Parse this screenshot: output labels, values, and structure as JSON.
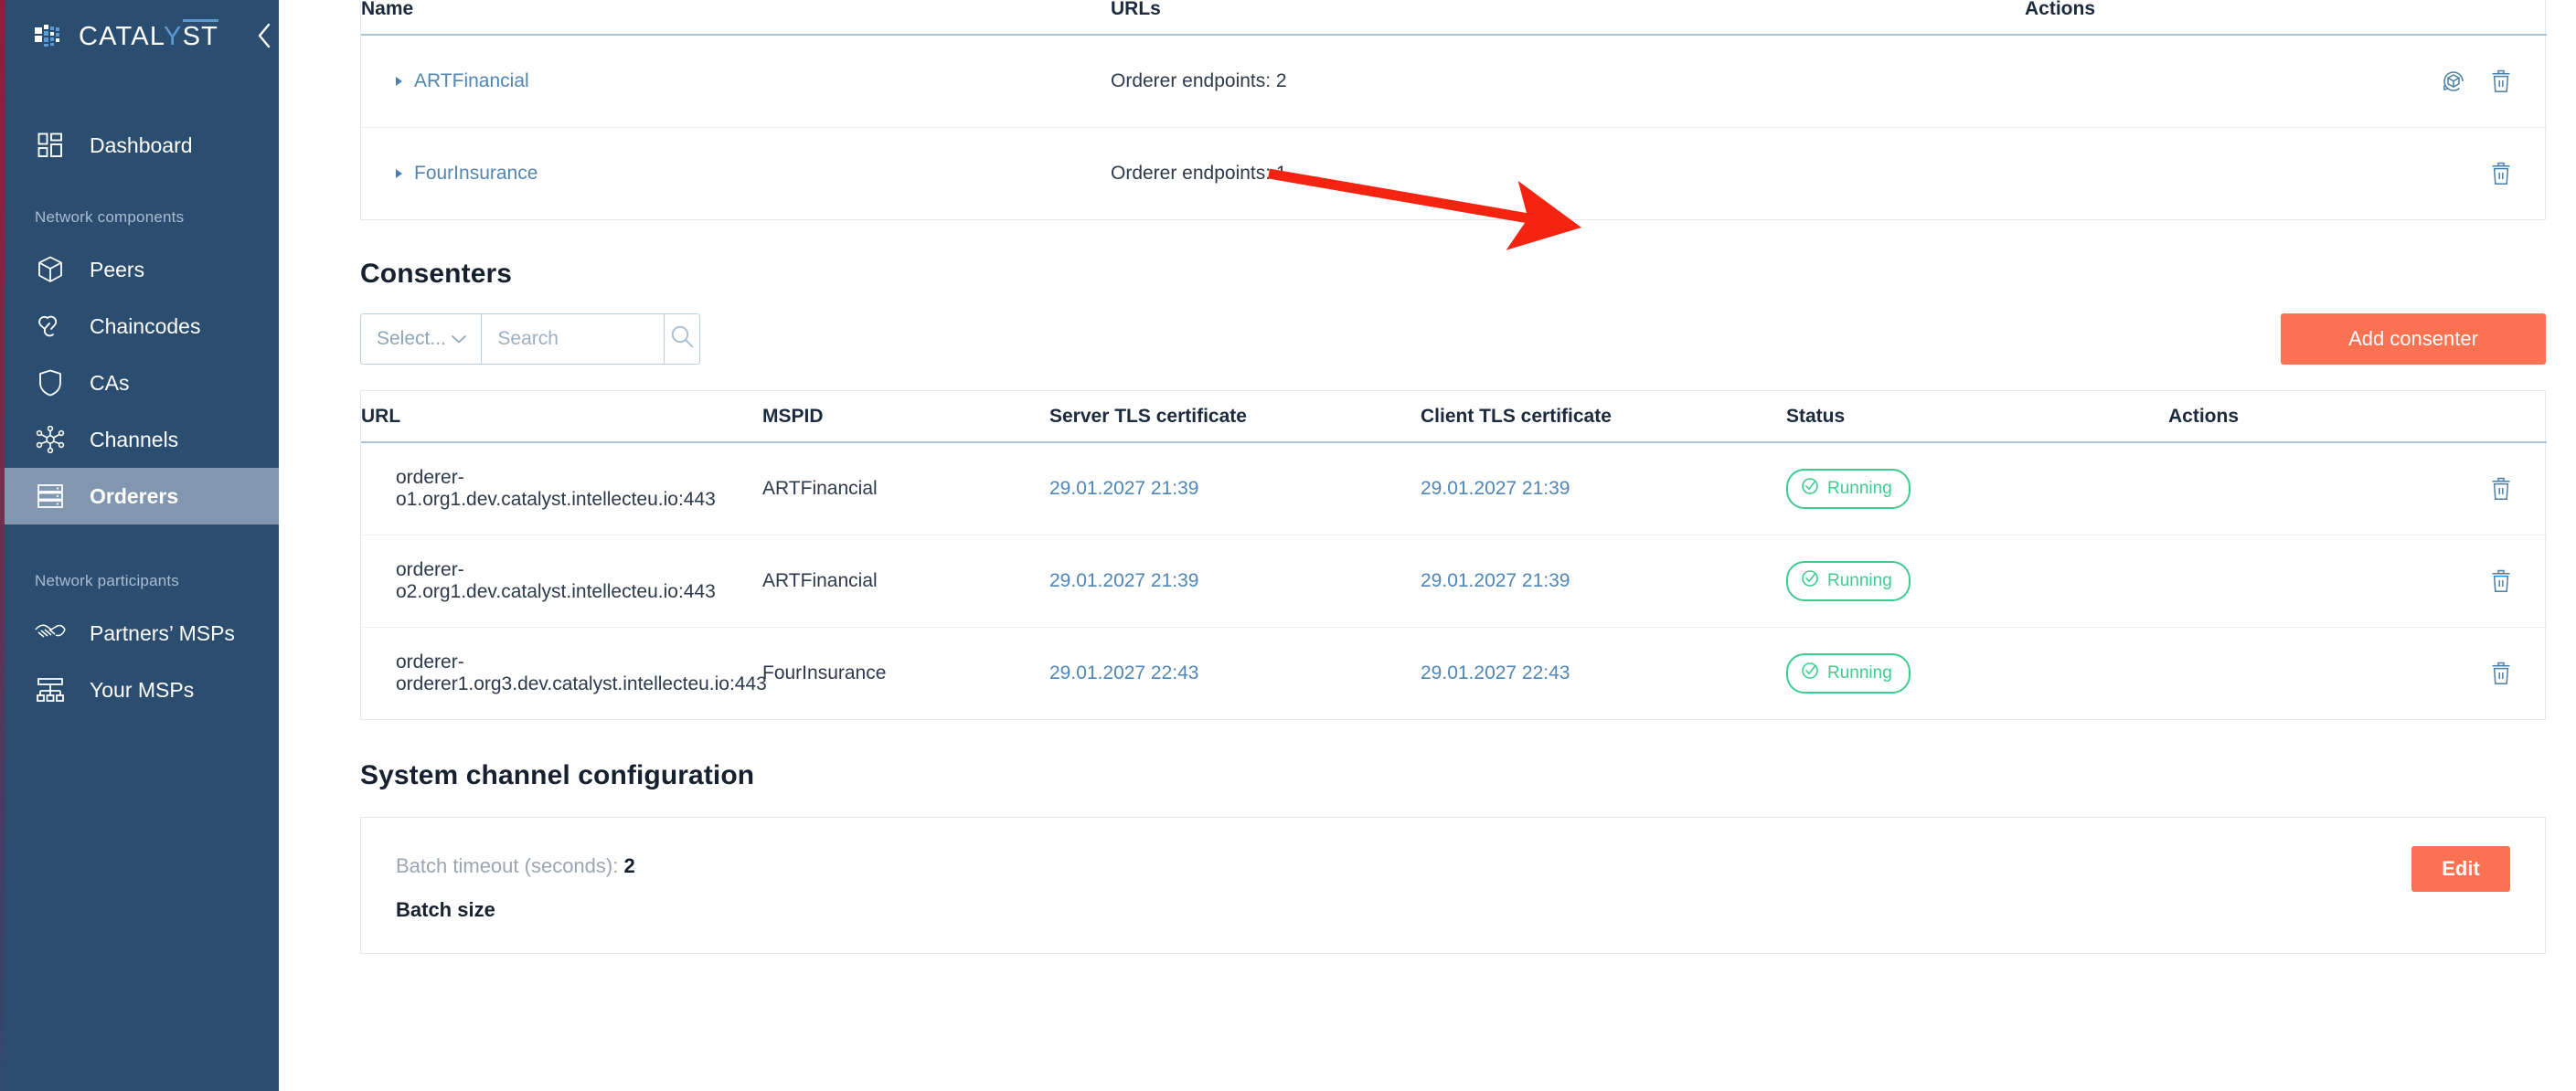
{
  "sidebar": {
    "brand": {
      "name_prefix": "CATAL",
      "name_accent": "Y",
      "name_suffix": "ST",
      "logo_icon": "catalyst-cube-logo-icon",
      "collapse_icon": "chevron-left-icon"
    },
    "groups": [
      {
        "label": "",
        "items": [
          {
            "label": "Dashboard",
            "icon": "dashboard-grid-icon",
            "active": false
          }
        ]
      },
      {
        "label": "Network components",
        "items": [
          {
            "label": "Peers",
            "icon": "cube-icon",
            "active": false
          },
          {
            "label": "Chaincodes",
            "icon": "link-chain-icon",
            "active": false
          },
          {
            "label": "CAs",
            "icon": "shield-icon",
            "active": false
          },
          {
            "label": "Channels",
            "icon": "network-nodes-icon",
            "active": false
          },
          {
            "label": "Orderers",
            "icon": "server-stack-icon",
            "active": true
          }
        ]
      },
      {
        "label": "Network participants",
        "items": [
          {
            "label": "Partners’ MSPs",
            "icon": "handshake-icon",
            "active": false
          },
          {
            "label": "Your MSPs",
            "icon": "org-hierarchy-icon",
            "active": false
          }
        ]
      }
    ]
  },
  "orderers_table": {
    "columns": [
      "Name",
      "URLs",
      "Actions"
    ],
    "rows": [
      {
        "name": "ARTFinancial",
        "urls": "Orderer endpoints: 2",
        "actions": [
          "restart-icon",
          "delete-icon"
        ]
      },
      {
        "name": "FourInsurance",
        "urls": "Orderer endpoints: 1",
        "actions": [
          "delete-icon"
        ]
      }
    ]
  },
  "consenters": {
    "title": "Consenters",
    "filter": {
      "select_value": "Select...",
      "search_placeholder": "Search",
      "search_value": "",
      "search_icon": "search-icon",
      "chevron_icon": "chevron-down-icon"
    },
    "add_button": {
      "label": "Add consenter",
      "color": "#fa7252"
    },
    "columns": [
      "URL",
      "MSPID",
      "Server TLS certificate",
      "Client TLS certificate",
      "Status",
      "Actions"
    ],
    "rows": [
      {
        "url": "orderer-o1.org1.dev.catalyst.intellecteu.io:443",
        "mspid": "ARTFinancial",
        "server_tls": "29.01.2027 21:39",
        "client_tls": "29.01.2027 21:39",
        "status": "Running",
        "action": "delete-icon"
      },
      {
        "url": "orderer-o2.org1.dev.catalyst.intellecteu.io:443",
        "mspid": "ARTFinancial",
        "server_tls": "29.01.2027 21:39",
        "client_tls": "29.01.2027 21:39",
        "status": "Running",
        "action": "delete-icon"
      },
      {
        "url": "orderer-orderer1.org3.dev.catalyst.intellecteu.io:443",
        "mspid": "FourInsurance",
        "server_tls": "29.01.2027 22:43",
        "client_tls": "29.01.2027 22:43",
        "status": "Running",
        "action": "delete-icon"
      }
    ],
    "status_color": "#3dcc8f"
  },
  "system_channel": {
    "title": "System channel configuration",
    "batch_timeout_label": "Batch timeout (seconds):",
    "batch_timeout_value": "2",
    "batch_size_label": "Batch size",
    "edit_button": {
      "label": "Edit",
      "color": "#fa7252"
    }
  },
  "annotation": {
    "arrow_color": "#f52410",
    "points_to": "add-consenter-button"
  }
}
